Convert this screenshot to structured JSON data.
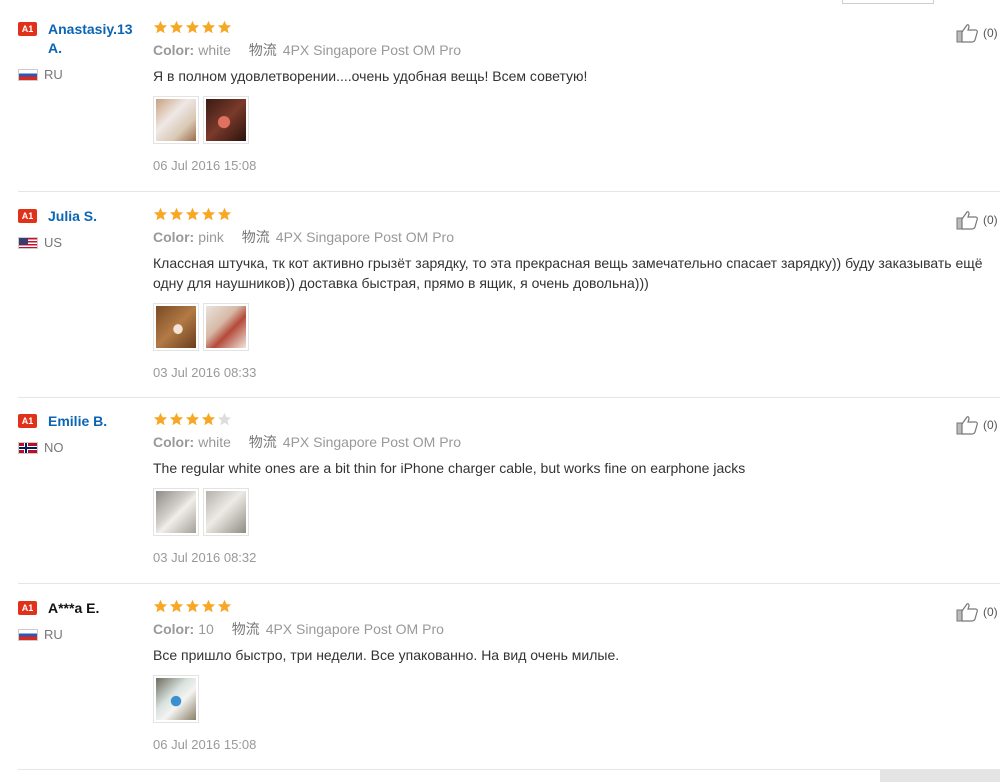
{
  "reviews": [
    {
      "level": "A1",
      "name": "Anastasiy.13 A.",
      "country": "RU",
      "flag": "ru",
      "rating": 5,
      "option_label": "Color:",
      "option_value": "white",
      "shipping_icon": "物流",
      "shipping": "4PX Singapore Post OM Pro",
      "text": "Я в полном удовлетворении....очень удобная вещь! Всем советую!",
      "photos": 2,
      "date": "06 Jul 2016 15:08",
      "helpful_label": "(0)"
    },
    {
      "level": "A1",
      "name": "Julia S.",
      "country": "US",
      "flag": "us",
      "rating": 5,
      "option_label": "Color:",
      "option_value": "pink",
      "shipping_icon": "物流",
      "shipping": "4PX Singapore Post OM Pro",
      "text": "Классная штучка, тк кот активно грызёт зарядку, то эта прекрасная вещь замечательно спасает зарядку)) буду заказывать ещё одну для наушников)) доставка быстрая, прямо в ящик, я очень довольна)))",
      "photos": 2,
      "date": "03 Jul 2016 08:33",
      "helpful_label": "(0)"
    },
    {
      "level": "A1",
      "name": "Emilie B.",
      "country": "NO",
      "flag": "no",
      "rating": 4,
      "option_label": "Color:",
      "option_value": "white",
      "shipping_icon": "物流",
      "shipping": "4PX Singapore Post OM Pro",
      "text": "The regular white ones are a bit thin for iPhone charger cable, but works fine on earphone jacks",
      "photos": 2,
      "date": "03 Jul 2016 08:32",
      "helpful_label": "(0)"
    },
    {
      "level": "A1",
      "name": "A***a E.",
      "country": "RU",
      "flag": "ru",
      "rating": 5,
      "option_label": "Color:",
      "option_value": "10",
      "shipping_icon": "物流",
      "shipping": "4PX Singapore Post OM Pro",
      "text": "Все пришло быстро, три недели. Все упакованно. На вид очень милые.",
      "photos": 1,
      "date": "06 Jul 2016 15:08",
      "helpful_label": "(0)"
    }
  ],
  "colors": {
    "star": "#f7a723",
    "star_empty": "#dddddd",
    "name_link": "#0b65b3",
    "level_badge": "#e0321b"
  }
}
